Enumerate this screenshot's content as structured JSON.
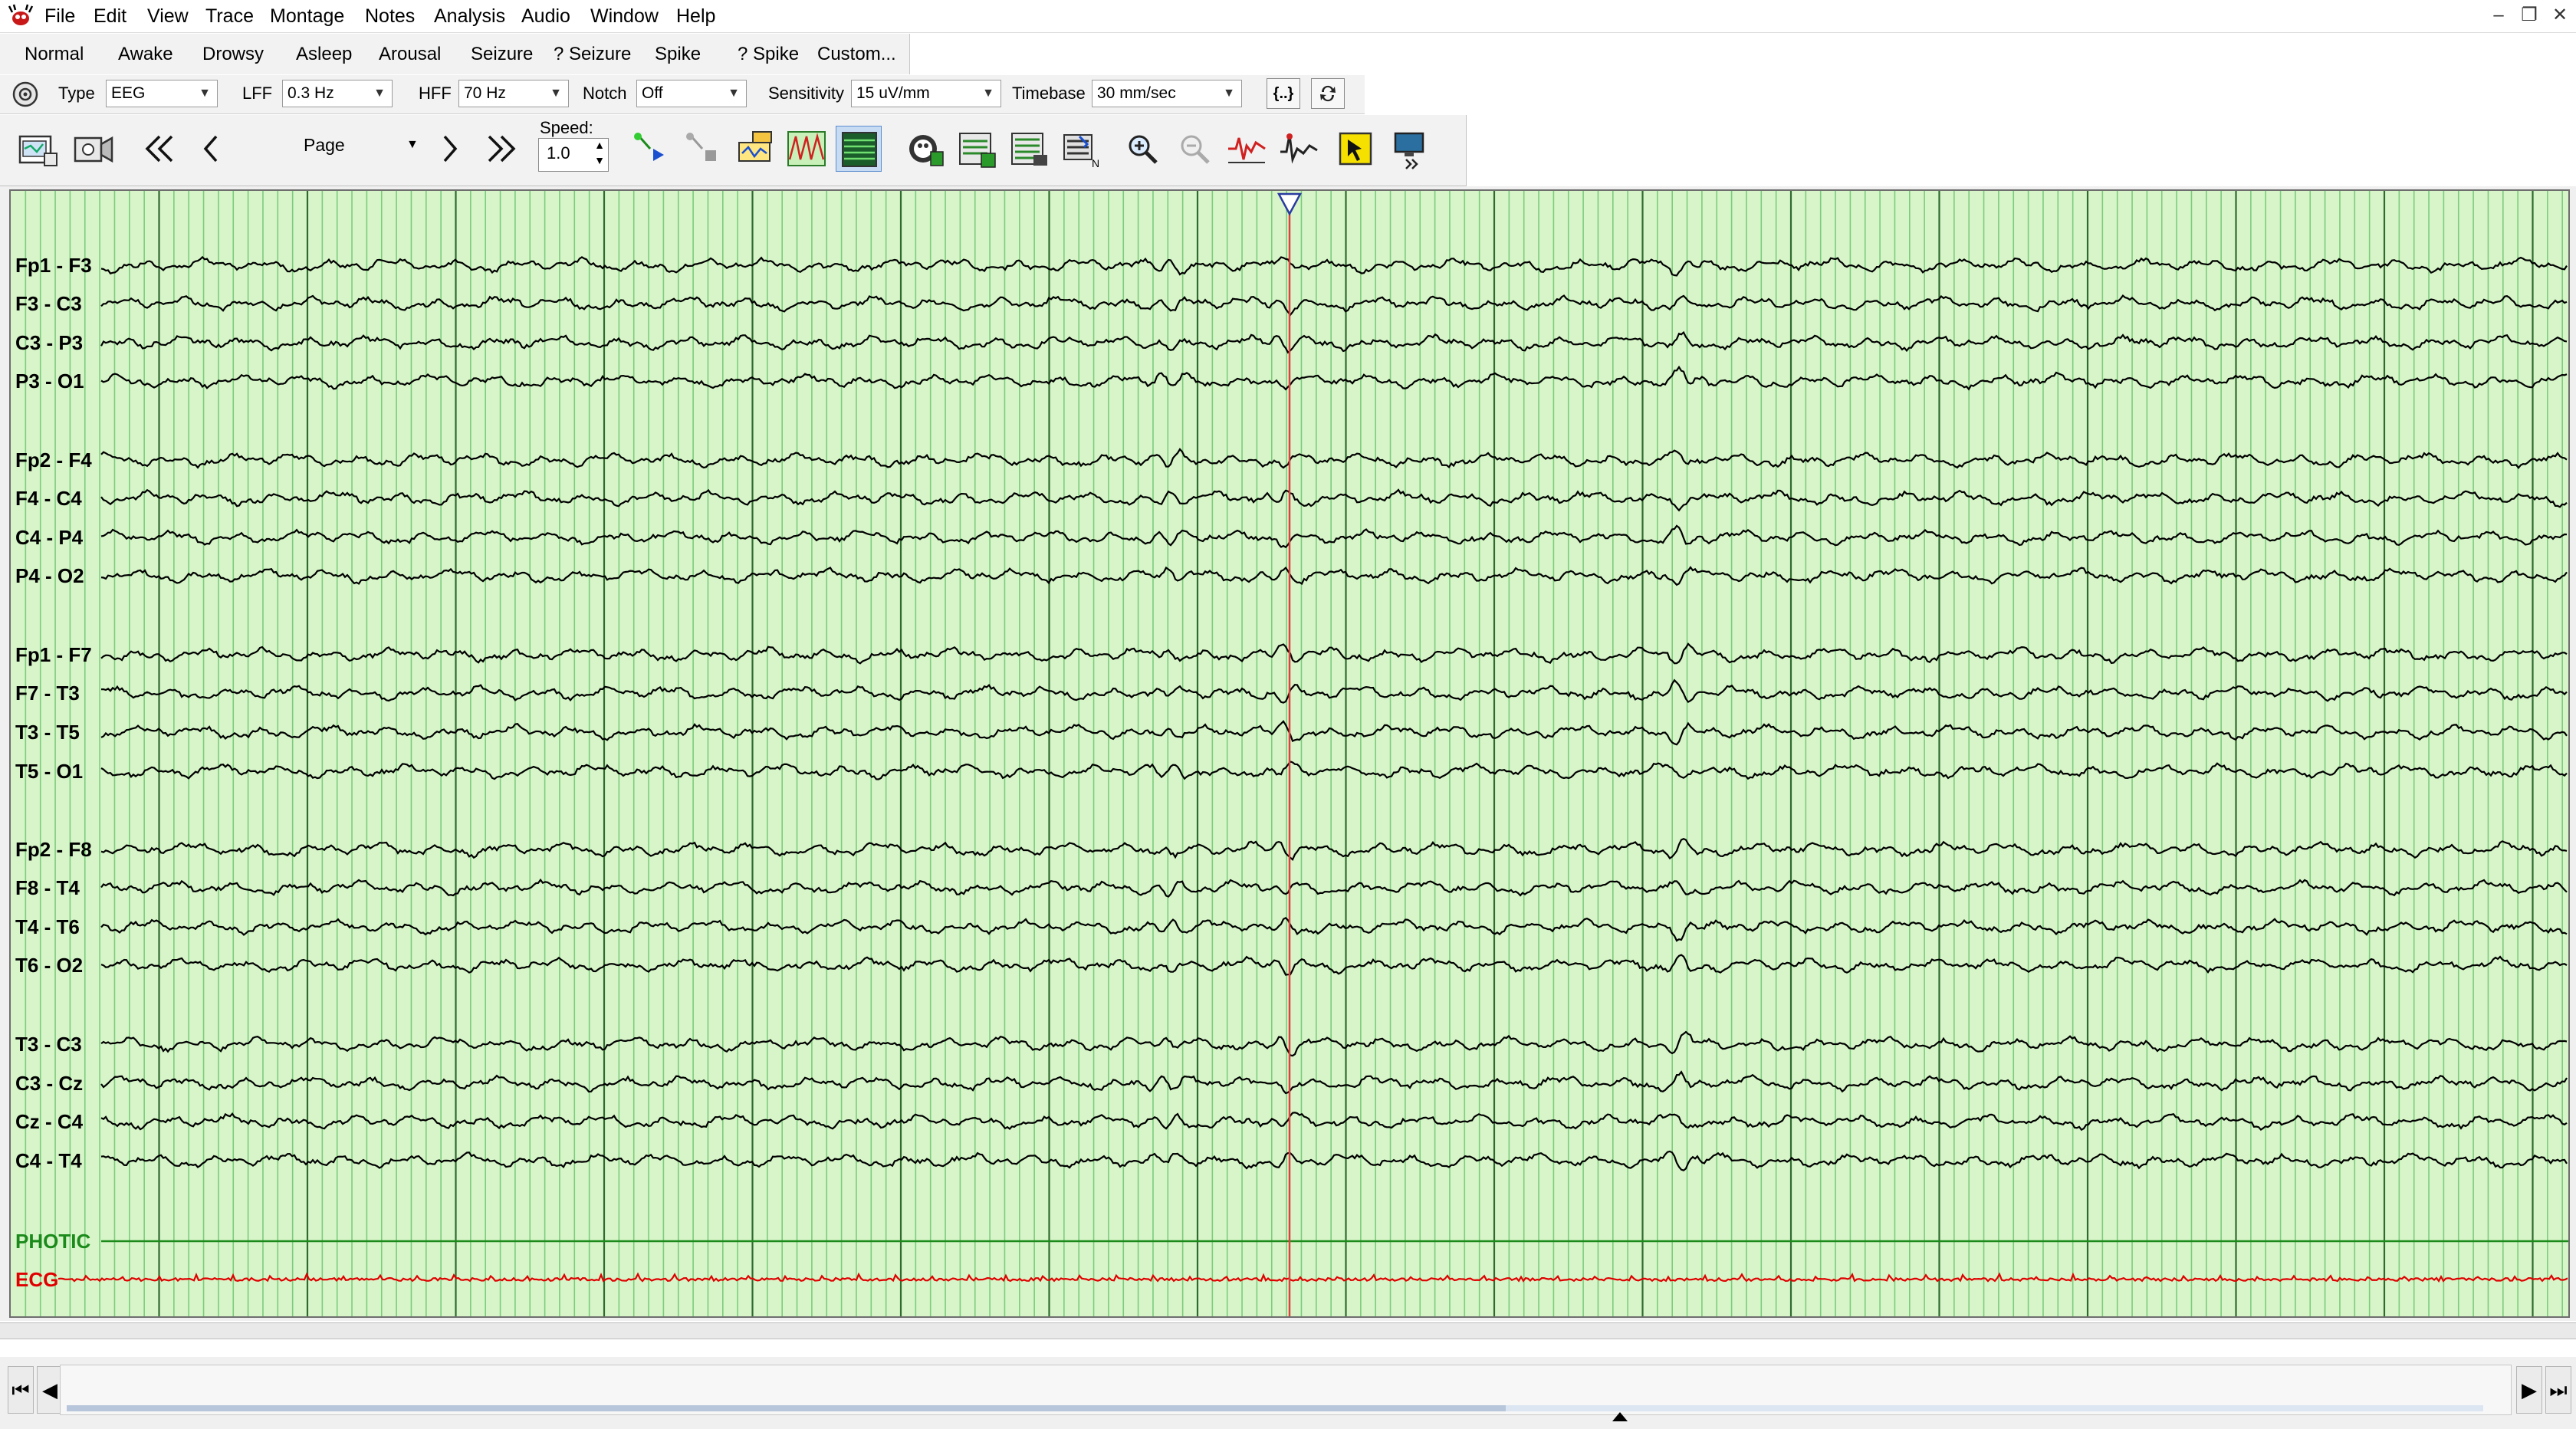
{
  "menu": [
    "File",
    "Edit",
    "View",
    "Trace",
    "Montage",
    "Notes",
    "Analysis",
    "Audio",
    "Window",
    "Help"
  ],
  "window_controls": {
    "minimize": "–",
    "restore": "❐",
    "close": "✕"
  },
  "marker_buttons": [
    "Normal",
    "Awake",
    "Drowsy",
    "Asleep",
    "Arousal",
    "Seizure",
    "? Seizure",
    "Spike",
    "? Spike",
    "Custom..."
  ],
  "settings": {
    "type_label": "Type",
    "type_value": "EEG",
    "lff_label": "LFF",
    "lff_value": "0.3 Hz",
    "hff_label": "HFF",
    "hff_value": "70 Hz",
    "notch_label": "Notch",
    "notch_value": "Off",
    "sensitivity_label": "Sensitivity",
    "sensitivity_value": "15 uV/mm",
    "timebase_label": "Timebase",
    "timebase_value": "30 mm/sec",
    "bracket_button": "{..}"
  },
  "toolbar": {
    "page_mode": "Page",
    "speed_label": "Speed:",
    "speed_value": "1.0"
  },
  "channels": [
    {
      "label": "Fp1 - F3",
      "group": 0,
      "type": "eeg"
    },
    {
      "label": "F3 - C3",
      "group": 0,
      "type": "eeg"
    },
    {
      "label": "C3 - P3",
      "group": 0,
      "type": "eeg"
    },
    {
      "label": "P3 - O1",
      "group": 0,
      "type": "eeg"
    },
    {
      "label": "Fp2 - F4",
      "group": 1,
      "type": "eeg"
    },
    {
      "label": "F4 - C4",
      "group": 1,
      "type": "eeg"
    },
    {
      "label": "C4 - P4",
      "group": 1,
      "type": "eeg"
    },
    {
      "label": "P4 - O2",
      "group": 1,
      "type": "eeg"
    },
    {
      "label": "Fp1 - F7",
      "group": 2,
      "type": "eeg"
    },
    {
      "label": "F7 - T3",
      "group": 2,
      "type": "eeg"
    },
    {
      "label": "T3 - T5",
      "group": 2,
      "type": "eeg"
    },
    {
      "label": "T5 - O1",
      "group": 2,
      "type": "eeg"
    },
    {
      "label": "Fp2 - F8",
      "group": 3,
      "type": "eeg"
    },
    {
      "label": "F8 - T4",
      "group": 3,
      "type": "eeg"
    },
    {
      "label": "T4 - T6",
      "group": 3,
      "type": "eeg"
    },
    {
      "label": "T6 - O2",
      "group": 3,
      "type": "eeg"
    },
    {
      "label": "T3 - C3",
      "group": 4,
      "type": "eeg"
    },
    {
      "label": "C3 - Cz",
      "group": 4,
      "type": "eeg"
    },
    {
      "label": "Cz - C4",
      "group": 4,
      "type": "eeg"
    },
    {
      "label": "C4 - T4",
      "group": 4,
      "type": "eeg"
    },
    {
      "label": "PHOTIC",
      "group": 5,
      "type": "photic"
    },
    {
      "label": "ECG",
      "group": 5,
      "type": "ecg"
    }
  ],
  "colors": {
    "trace_bg": "#d7f5c9",
    "grid_major": "#2f6b2f",
    "grid_minor": "#7ccc7c",
    "trace": "#000000",
    "photic": "#1b8a1b",
    "ecg": "#e00000",
    "cursor": "#e04040"
  },
  "scrollbar": {
    "position_fraction": 0.59
  }
}
